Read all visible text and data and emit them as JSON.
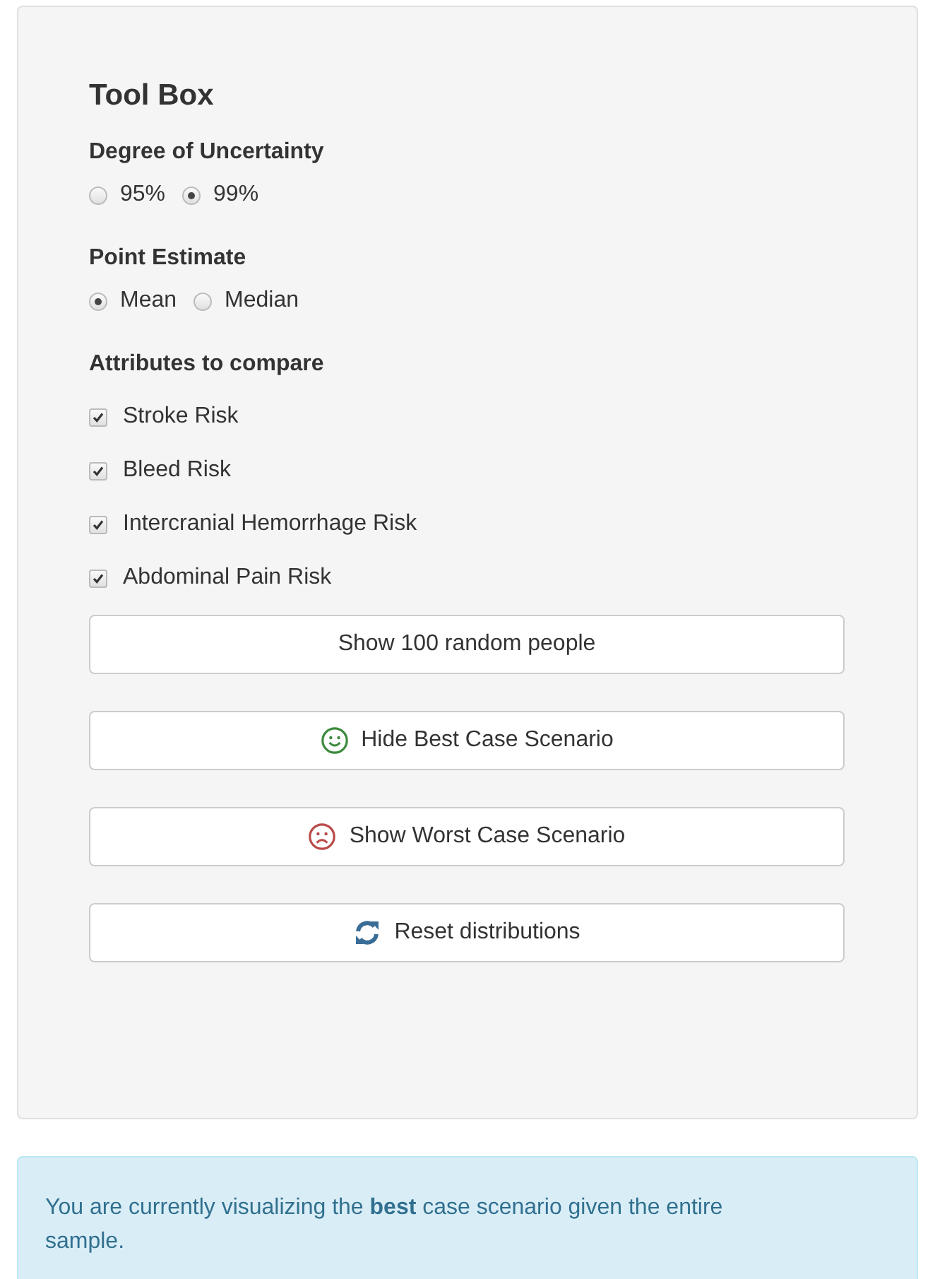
{
  "toolbox": {
    "title": "Tool Box",
    "uncertainty": {
      "label": "Degree of Uncertainty",
      "options": [
        {
          "label": "95%",
          "selected": false
        },
        {
          "label": "99%",
          "selected": true
        }
      ]
    },
    "point_estimate": {
      "label": "Point Estimate",
      "options": [
        {
          "label": "Mean",
          "selected": true
        },
        {
          "label": "Median",
          "selected": false
        }
      ]
    },
    "attributes": {
      "label": "Attributes to compare",
      "items": [
        {
          "label": "Stroke Risk",
          "checked": true
        },
        {
          "label": "Bleed Risk",
          "checked": true
        },
        {
          "label": "Intercranial Hemorrhage Risk",
          "checked": true
        },
        {
          "label": "Abdominal Pain Risk",
          "checked": true
        }
      ]
    },
    "buttons": [
      {
        "label": "Show 100 random people",
        "kind": "plain"
      },
      {
        "label": "Hide Best Case Scenario",
        "kind": "smile"
      },
      {
        "label": "Show Worst Case Scenario",
        "kind": "frown"
      },
      {
        "label": "Reset distributions",
        "kind": "refresh"
      }
    ]
  },
  "info": "You are currently visualizing the **best** case scenario given the entire sample."
}
